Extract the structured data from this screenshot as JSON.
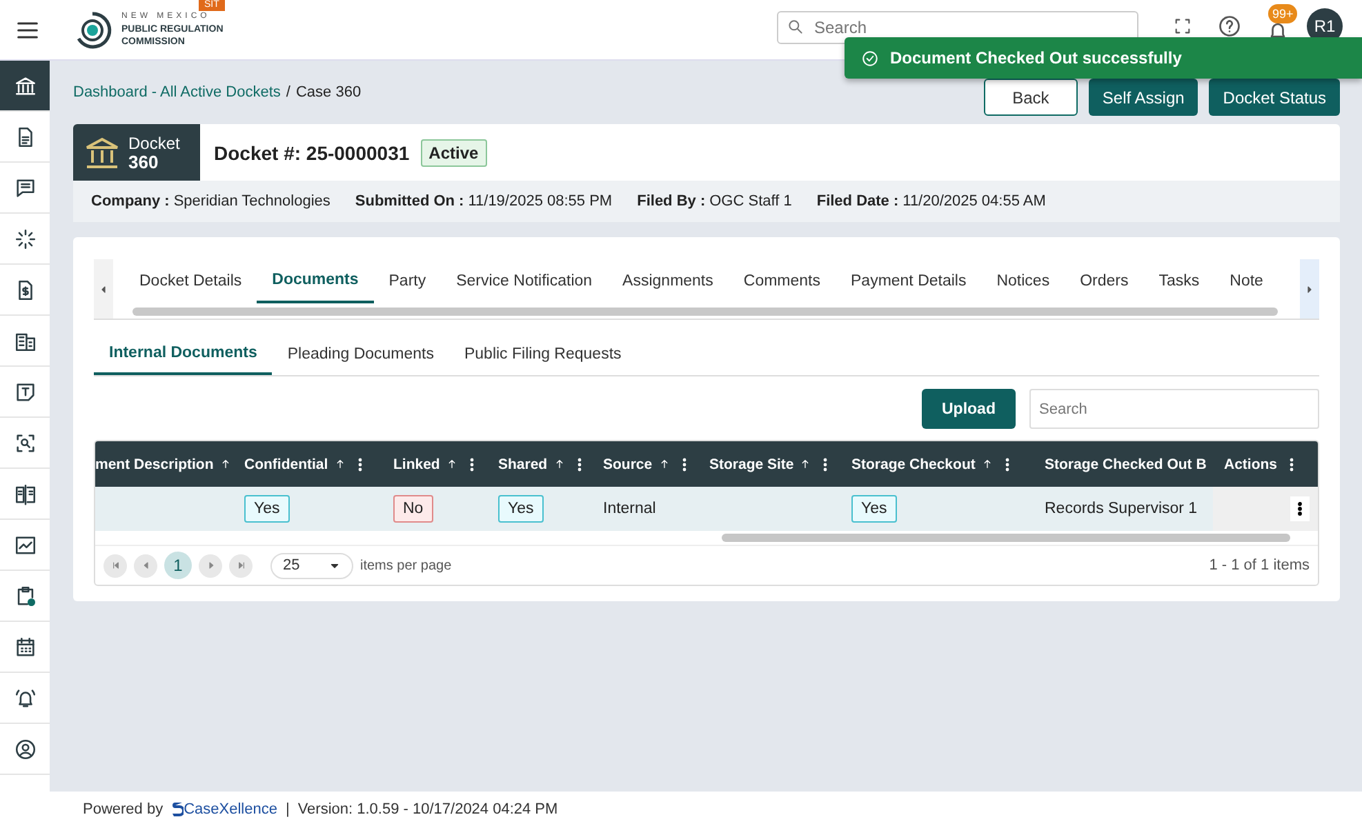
{
  "header": {
    "org_line_1": "NEW MEXICO",
    "org_line_2": "PUBLIC REGULATION",
    "org_line_3": "COMMISSION",
    "env_badge": "SIT",
    "search": {
      "placeholder": "Search"
    },
    "notification_count": "99+",
    "avatar": "R1"
  },
  "toast": {
    "message": "Document Checked Out successfully"
  },
  "sidebar": {
    "items": [
      {
        "selected": true
      },
      {
        "selected": false
      },
      {
        "selected": false
      },
      {
        "selected": false
      },
      {
        "selected": false
      },
      {
        "selected": false
      },
      {
        "selected": false
      },
      {
        "selected": false
      },
      {
        "selected": false
      },
      {
        "selected": false
      },
      {
        "selected": false
      },
      {
        "selected": false
      },
      {
        "selected": false
      },
      {
        "selected": false
      }
    ]
  },
  "breadcrumb": {
    "link": "Dashboard - All Active Dockets",
    "separator": "/",
    "current": "Case 360"
  },
  "actions": [
    {
      "label": "Back",
      "kind": "outline"
    },
    {
      "label": "Self Assign",
      "kind": "solid"
    },
    {
      "label": "Docket Status",
      "kind": "solid"
    }
  ],
  "docket": {
    "badge_line_1": "Docket",
    "badge_line_2": "360",
    "number": "Docket #: 25-0000031",
    "status": "Active"
  },
  "info": [
    {
      "label": "Company :",
      "value": "Speridian Technologies"
    },
    {
      "label": "Submitted On :",
      "value": "11/19/2025 08:55 PM"
    },
    {
      "label": "Filed By :",
      "value": "OGC Staff 1"
    },
    {
      "label": "Filed Date :",
      "value": "11/20/2025 04:55 AM"
    }
  ],
  "tabs": [
    {
      "label": "Docket Details",
      "selected": false
    },
    {
      "label": "Documents",
      "selected": true
    },
    {
      "label": "Party",
      "selected": false
    },
    {
      "label": "Service Notification",
      "selected": false
    },
    {
      "label": "Assignments",
      "selected": false
    },
    {
      "label": "Comments",
      "selected": false
    },
    {
      "label": "Payment Details",
      "selected": false
    },
    {
      "label": "Notices",
      "selected": false
    },
    {
      "label": "Orders",
      "selected": false
    },
    {
      "label": "Tasks",
      "selected": false
    },
    {
      "label": "Note",
      "selected": false
    }
  ],
  "subtabs": [
    {
      "label": "Internal Documents",
      "selected": true
    },
    {
      "label": "Pleading Documents",
      "selected": false
    },
    {
      "label": "Public Filing Requests",
      "selected": false
    }
  ],
  "upload_button": "Upload",
  "table_search": {
    "placeholder": "Search"
  },
  "table": {
    "columns": [
      {
        "label": "ment Description",
        "sortable": true,
        "menu": false
      },
      {
        "label": "Confidential",
        "sortable": true,
        "menu": true
      },
      {
        "label": "Linked",
        "sortable": true,
        "menu": true
      },
      {
        "label": "Shared",
        "sortable": true,
        "menu": true
      },
      {
        "label": "Source",
        "sortable": true,
        "menu": true
      },
      {
        "label": "Storage Site",
        "sortable": true,
        "menu": true
      },
      {
        "label": "Storage Checkout",
        "sortable": true,
        "menu": true
      },
      {
        "label": "Storage Checked Out B",
        "sortable": false,
        "menu": false
      },
      {
        "label": "Actions",
        "sortable": false,
        "menu": true
      }
    ],
    "rows": [
      [
        {
          "kind": "plain",
          "text": ""
        },
        {
          "kind": "positive",
          "text": "Yes"
        },
        {
          "kind": "negative",
          "text": "No"
        },
        {
          "kind": "positive",
          "text": "Yes"
        },
        {
          "kind": "plain",
          "text": "Internal"
        },
        {
          "kind": "plain",
          "text": ""
        },
        {
          "kind": "positive",
          "text": "Yes"
        },
        {
          "kind": "plain",
          "text": "Records Supervisor 1"
        },
        {
          "kind": "menu"
        }
      ]
    ]
  },
  "pager": {
    "pages": [
      {
        "label": "1",
        "selected": true
      }
    ],
    "page_size": "25",
    "page_size_label": "items per page",
    "summary": "1 - 1 of 1 items"
  },
  "footer": {
    "powered_by": "Powered by",
    "brand": "CaseXellence",
    "separator": "|",
    "version": "Version: 1.0.59 - 10/17/2024 04:24 PM"
  }
}
